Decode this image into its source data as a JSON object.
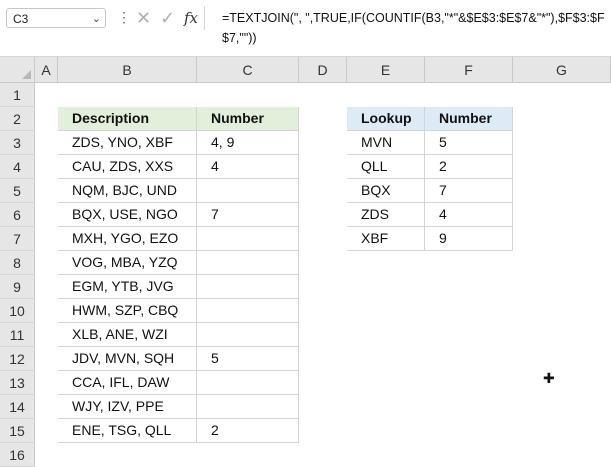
{
  "formula_bar": {
    "name_box": "C3",
    "formula": "=TEXTJOIN(\", \",TRUE,IF(COUNTIF(B3,\"*\"&$E$3:$E$7&\"*\"),$F$3:$F$7,\"\"))"
  },
  "columns": [
    "A",
    "B",
    "C",
    "D",
    "E",
    "F",
    "G"
  ],
  "rows": [
    "1",
    "2",
    "3",
    "4",
    "5",
    "6",
    "7",
    "8",
    "9",
    "10",
    "11",
    "12",
    "13",
    "14",
    "15",
    "16"
  ],
  "table1": {
    "headers": [
      "Description",
      "Number"
    ],
    "rows": [
      [
        "ZDS, YNO, XBF",
        "4, 9"
      ],
      [
        "CAU, ZDS, XXS",
        "4"
      ],
      [
        "NQM, BJC, UND",
        ""
      ],
      [
        "BQX, USE, NGO",
        "7"
      ],
      [
        "MXH, YGO, EZO",
        ""
      ],
      [
        "VOG, MBA, YZQ",
        ""
      ],
      [
        "EGM, YTB, JVG",
        ""
      ],
      [
        "HWM, SZP, CBQ",
        ""
      ],
      [
        "XLB, ANE, WZI",
        ""
      ],
      [
        "JDV, MVN, SQH",
        "5"
      ],
      [
        "CCA, IFL, DAW",
        ""
      ],
      [
        "WJY, IZV, PPE",
        ""
      ],
      [
        "ENE, TSG, QLL",
        "2"
      ]
    ]
  },
  "table2": {
    "headers": [
      "Lookup",
      "Number"
    ],
    "rows": [
      [
        "MVN",
        "5"
      ],
      [
        "QLL",
        "2"
      ],
      [
        "BQX",
        "7"
      ],
      [
        "ZDS",
        "4"
      ],
      [
        "XBF",
        "9"
      ]
    ]
  },
  "colors": {
    "header_green": "#e2efda",
    "header_blue": "#ddebf7",
    "grid_header": "#e6e6e6"
  },
  "icons": [
    "chevron-down-icon",
    "more-options-icon",
    "cancel-icon",
    "enter-icon",
    "function-icon",
    "cell-cursor-icon"
  ]
}
